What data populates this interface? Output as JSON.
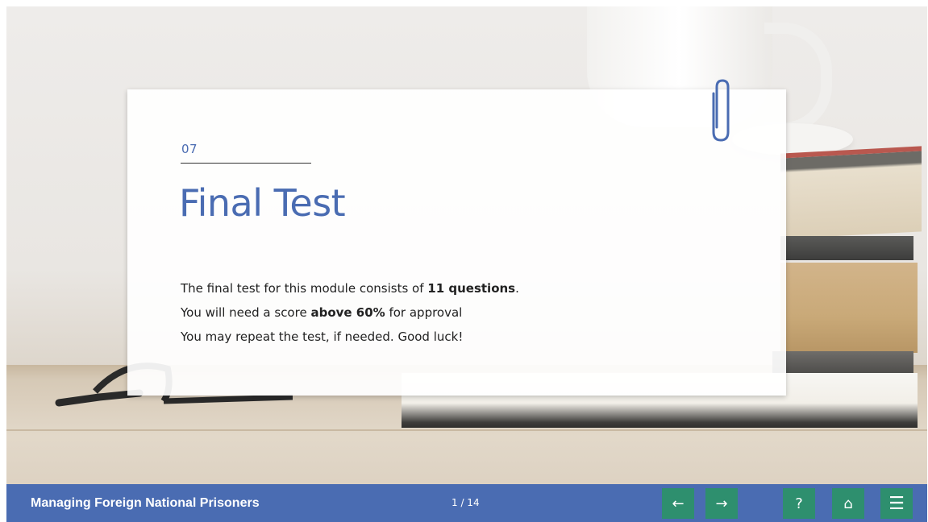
{
  "slide": {
    "number": "07",
    "title": "Final Test",
    "lines": [
      {
        "pre": "The final test for this module consists of ",
        "bold": "11 questions",
        "post": "."
      },
      {
        "pre": "You will need a score ",
        "bold": "above 60%",
        "post": " for approval"
      },
      {
        "pre": "You may repeat the test, if needed. Good luck!",
        "bold": "",
        "post": ""
      }
    ]
  },
  "footer": {
    "course_title": "Managing Foreign National Prisoners",
    "pager": "1 / 14",
    "buttons": {
      "prev": "←",
      "next": "→",
      "help": "?",
      "home": "⌂",
      "menu": "☰"
    }
  },
  "colors": {
    "accent": "#4a6cb2",
    "button": "#2e8f6e"
  }
}
